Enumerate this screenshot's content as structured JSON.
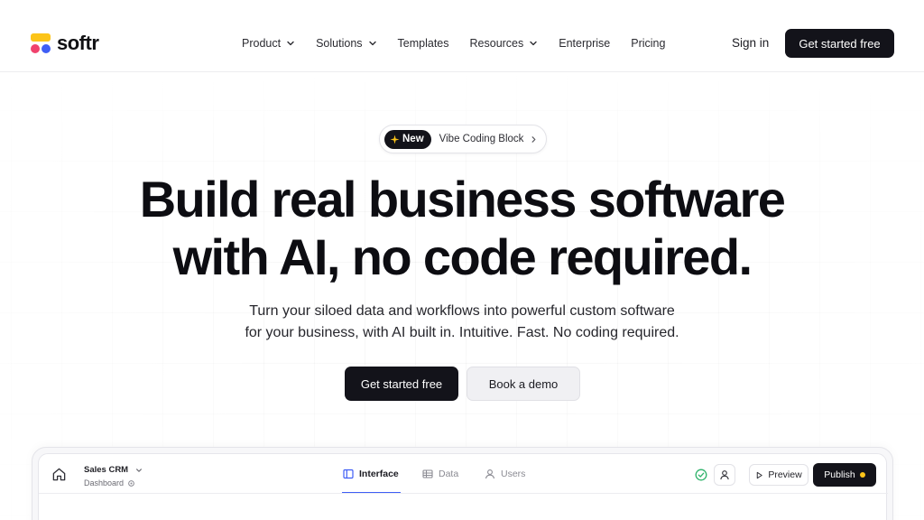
{
  "nav": {
    "logo_text": "softr",
    "menu": [
      {
        "label": "Product",
        "dropdown": true
      },
      {
        "label": "Solutions",
        "dropdown": true
      },
      {
        "label": "Templates",
        "dropdown": false
      },
      {
        "label": "Resources",
        "dropdown": true
      },
      {
        "label": "Enterprise",
        "dropdown": false
      },
      {
        "label": "Pricing",
        "dropdown": false
      }
    ],
    "sign_in": "Sign in",
    "cta": "Get started free"
  },
  "hero": {
    "badge": "New",
    "badge_text": "Vibe Coding Block",
    "headline_line1": "Build real business software",
    "headline_line2": "with AI, no code required.",
    "sub_line1": "Turn your siloed data and workflows into powerful custom software",
    "sub_line2": "for your business, with AI built in. Intuitive. Fast. No coding required.",
    "cta_primary": "Get started free",
    "cta_secondary": "Book a demo"
  },
  "app_preview": {
    "project_name": "Sales CRM",
    "page_name": "Dashboard",
    "tabs": [
      {
        "label": "Interface",
        "icon": "layout-icon",
        "active": true
      },
      {
        "label": "Data",
        "icon": "table-icon",
        "active": false
      },
      {
        "label": "Users",
        "icon": "user-icon",
        "active": false
      }
    ],
    "preview_label": "Preview",
    "publish_label": "Publish"
  },
  "colors": {
    "brand_yellow": "#fcc419",
    "brand_red": "#f0426d",
    "brand_blue": "#3f5ef5",
    "dark": "#13131a",
    "status_green": "#2fb36b"
  }
}
